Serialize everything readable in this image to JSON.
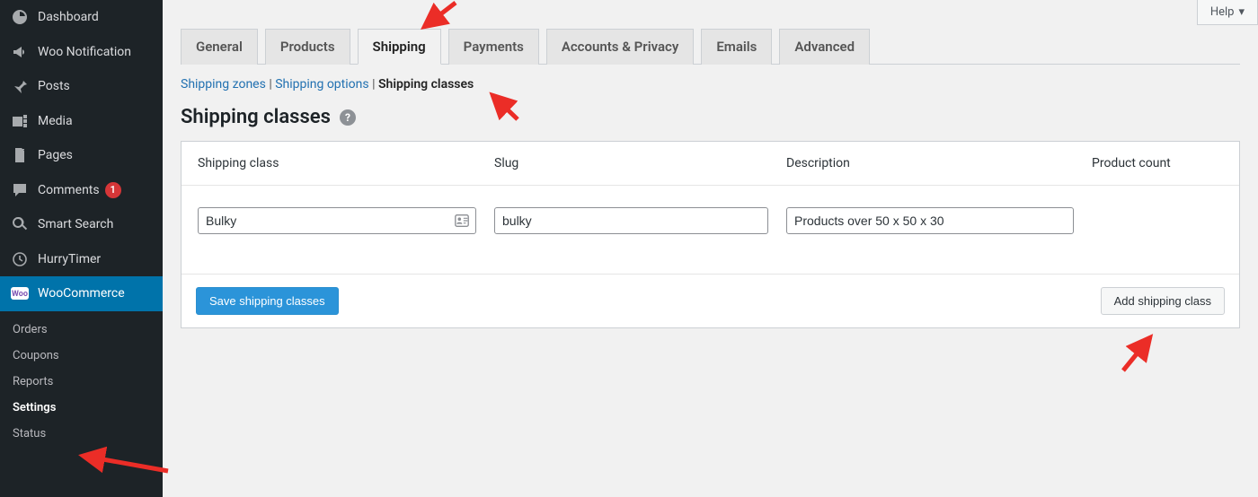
{
  "help": {
    "label": "Help"
  },
  "sidebar": {
    "items": [
      {
        "label": "Dashboard",
        "icon": "dashboard-icon"
      },
      {
        "label": "Woo Notification",
        "icon": "megaphone-icon"
      },
      {
        "label": "Posts",
        "icon": "pin-icon"
      },
      {
        "label": "Media",
        "icon": "media-icon"
      },
      {
        "label": "Pages",
        "icon": "pages-icon"
      },
      {
        "label": "Comments",
        "icon": "comment-icon",
        "badge": "1"
      },
      {
        "label": "Smart Search",
        "icon": "search-icon"
      },
      {
        "label": "HurryTimer",
        "icon": "clock-icon"
      },
      {
        "label": "WooCommerce",
        "icon": "woo-icon",
        "active": true
      }
    ],
    "submenu": [
      {
        "label": "Orders"
      },
      {
        "label": "Coupons"
      },
      {
        "label": "Reports"
      },
      {
        "label": "Settings",
        "current": true
      },
      {
        "label": "Status"
      }
    ]
  },
  "tabs": [
    {
      "label": "General"
    },
    {
      "label": "Products"
    },
    {
      "label": "Shipping",
      "active": true
    },
    {
      "label": "Payments"
    },
    {
      "label": "Accounts & Privacy"
    },
    {
      "label": "Emails"
    },
    {
      "label": "Advanced"
    }
  ],
  "subnav": {
    "zones": "Shipping zones",
    "options": "Shipping options",
    "classes": "Shipping classes"
  },
  "heading": "Shipping classes",
  "table": {
    "headers": {
      "class": "Shipping class",
      "slug": "Slug",
      "desc": "Description",
      "count": "Product count"
    },
    "row": {
      "class": "Bulky",
      "slug": "bulky",
      "desc": "Products over 50 x 50 x 30"
    }
  },
  "buttons": {
    "save": "Save shipping classes",
    "add": "Add shipping class"
  }
}
